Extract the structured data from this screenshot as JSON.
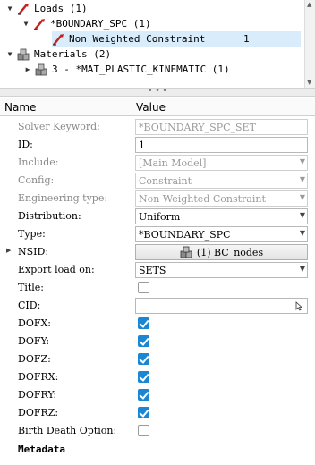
{
  "tree": {
    "items": [
      {
        "label": "Loads (1)",
        "expand": "▼",
        "icon": "load-icon"
      },
      {
        "label": "*BOUNDARY_SPC (1)",
        "expand": "▼",
        "icon": "load-icon"
      },
      {
        "label": "Non Weighted Constraint",
        "count": "1",
        "icon": "load-icon"
      },
      {
        "label": "Materials (2)",
        "expand": "▼",
        "icon": "material-icon"
      },
      {
        "label": "3 - *MAT_PLASTIC_KINEMATIC (1)",
        "expand": "▶",
        "icon": "material-icon"
      }
    ]
  },
  "splitter": {
    "grip": "• • •"
  },
  "grid": {
    "header": {
      "name": "Name",
      "value": "Value"
    },
    "rows": [
      {
        "label": "Solver Keyword:",
        "value": "*BOUNDARY_SPC_SET"
      },
      {
        "label": "ID:",
        "value": "1"
      },
      {
        "label": "Include:",
        "value": "[Main Model]"
      },
      {
        "label": "Config:",
        "value": "Constraint"
      },
      {
        "label": "Engineering type:",
        "value": "Non Weighted Constraint"
      },
      {
        "label": "Distribution:",
        "value": "Uniform"
      },
      {
        "label": "Type:",
        "value": "*BOUNDARY_SPC"
      },
      {
        "label": "NSID:",
        "value": "(1) BC_nodes",
        "expand": "▶"
      },
      {
        "label": "Export load on:",
        "value": "SETS"
      },
      {
        "label": "Title:",
        "checked": false
      },
      {
        "label": "CID:",
        "value": ""
      },
      {
        "label": "DOFX:",
        "checked": true
      },
      {
        "label": "DOFY:",
        "checked": true
      },
      {
        "label": "DOFZ:",
        "checked": true
      },
      {
        "label": "DOFRX:",
        "checked": true
      },
      {
        "label": "DOFRY:",
        "checked": true
      },
      {
        "label": "DOFRZ:",
        "checked": true
      },
      {
        "label": "Birth Death Option:",
        "checked": false
      }
    ],
    "section_metadata": "Metadata"
  },
  "colors": {
    "accent": "#1b86d1",
    "selected_row": "#d9ecfb",
    "load_red": "#c8201e"
  }
}
